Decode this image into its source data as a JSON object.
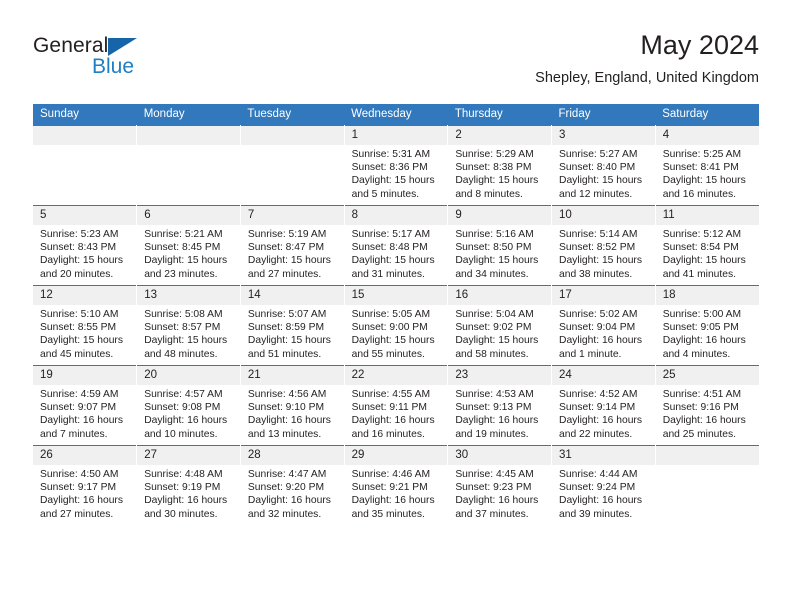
{
  "brand": {
    "name_top": "General",
    "name_bottom": "Blue",
    "triangle_color": "#1565a8",
    "blue_text_color": "#1f7fc4"
  },
  "header": {
    "title": "May 2024",
    "subtitle": "Shepley, England, United Kingdom"
  },
  "theme": {
    "header_bg": "#3278bc",
    "daynum_bg": "#f0f0f0",
    "text": "#231f20"
  },
  "columns": [
    "Sunday",
    "Monday",
    "Tuesday",
    "Wednesday",
    "Thursday",
    "Friday",
    "Saturday"
  ],
  "labels": {
    "sunrise_prefix": "Sunrise:",
    "sunset_prefix": "Sunset:",
    "daylight_prefix": "Daylight:"
  },
  "weeks": [
    [
      {
        "day": "",
        "sunrise": "",
        "sunset": "",
        "daylight_line1": "",
        "daylight_line2": ""
      },
      {
        "day": "",
        "sunrise": "",
        "sunset": "",
        "daylight_line1": "",
        "daylight_line2": ""
      },
      {
        "day": "",
        "sunrise": "",
        "sunset": "",
        "daylight_line1": "",
        "daylight_line2": ""
      },
      {
        "day": "1",
        "sunrise": "Sunrise: 5:31 AM",
        "sunset": "Sunset: 8:36 PM",
        "daylight_line1": "Daylight: 15 hours",
        "daylight_line2": "and 5 minutes."
      },
      {
        "day": "2",
        "sunrise": "Sunrise: 5:29 AM",
        "sunset": "Sunset: 8:38 PM",
        "daylight_line1": "Daylight: 15 hours",
        "daylight_line2": "and 8 minutes."
      },
      {
        "day": "3",
        "sunrise": "Sunrise: 5:27 AM",
        "sunset": "Sunset: 8:40 PM",
        "daylight_line1": "Daylight: 15 hours",
        "daylight_line2": "and 12 minutes."
      },
      {
        "day": "4",
        "sunrise": "Sunrise: 5:25 AM",
        "sunset": "Sunset: 8:41 PM",
        "daylight_line1": "Daylight: 15 hours",
        "daylight_line2": "and 16 minutes."
      }
    ],
    [
      {
        "day": "5",
        "sunrise": "Sunrise: 5:23 AM",
        "sunset": "Sunset: 8:43 PM",
        "daylight_line1": "Daylight: 15 hours",
        "daylight_line2": "and 20 minutes."
      },
      {
        "day": "6",
        "sunrise": "Sunrise: 5:21 AM",
        "sunset": "Sunset: 8:45 PM",
        "daylight_line1": "Daylight: 15 hours",
        "daylight_line2": "and 23 minutes."
      },
      {
        "day": "7",
        "sunrise": "Sunrise: 5:19 AM",
        "sunset": "Sunset: 8:47 PM",
        "daylight_line1": "Daylight: 15 hours",
        "daylight_line2": "and 27 minutes."
      },
      {
        "day": "8",
        "sunrise": "Sunrise: 5:17 AM",
        "sunset": "Sunset: 8:48 PM",
        "daylight_line1": "Daylight: 15 hours",
        "daylight_line2": "and 31 minutes."
      },
      {
        "day": "9",
        "sunrise": "Sunrise: 5:16 AM",
        "sunset": "Sunset: 8:50 PM",
        "daylight_line1": "Daylight: 15 hours",
        "daylight_line2": "and 34 minutes."
      },
      {
        "day": "10",
        "sunrise": "Sunrise: 5:14 AM",
        "sunset": "Sunset: 8:52 PM",
        "daylight_line1": "Daylight: 15 hours",
        "daylight_line2": "and 38 minutes."
      },
      {
        "day": "11",
        "sunrise": "Sunrise: 5:12 AM",
        "sunset": "Sunset: 8:54 PM",
        "daylight_line1": "Daylight: 15 hours",
        "daylight_line2": "and 41 minutes."
      }
    ],
    [
      {
        "day": "12",
        "sunrise": "Sunrise: 5:10 AM",
        "sunset": "Sunset: 8:55 PM",
        "daylight_line1": "Daylight: 15 hours",
        "daylight_line2": "and 45 minutes."
      },
      {
        "day": "13",
        "sunrise": "Sunrise: 5:08 AM",
        "sunset": "Sunset: 8:57 PM",
        "daylight_line1": "Daylight: 15 hours",
        "daylight_line2": "and 48 minutes."
      },
      {
        "day": "14",
        "sunrise": "Sunrise: 5:07 AM",
        "sunset": "Sunset: 8:59 PM",
        "daylight_line1": "Daylight: 15 hours",
        "daylight_line2": "and 51 minutes."
      },
      {
        "day": "15",
        "sunrise": "Sunrise: 5:05 AM",
        "sunset": "Sunset: 9:00 PM",
        "daylight_line1": "Daylight: 15 hours",
        "daylight_line2": "and 55 minutes."
      },
      {
        "day": "16",
        "sunrise": "Sunrise: 5:04 AM",
        "sunset": "Sunset: 9:02 PM",
        "daylight_line1": "Daylight: 15 hours",
        "daylight_line2": "and 58 minutes."
      },
      {
        "day": "17",
        "sunrise": "Sunrise: 5:02 AM",
        "sunset": "Sunset: 9:04 PM",
        "daylight_line1": "Daylight: 16 hours",
        "daylight_line2": "and 1 minute."
      },
      {
        "day": "18",
        "sunrise": "Sunrise: 5:00 AM",
        "sunset": "Sunset: 9:05 PM",
        "daylight_line1": "Daylight: 16 hours",
        "daylight_line2": "and 4 minutes."
      }
    ],
    [
      {
        "day": "19",
        "sunrise": "Sunrise: 4:59 AM",
        "sunset": "Sunset: 9:07 PM",
        "daylight_line1": "Daylight: 16 hours",
        "daylight_line2": "and 7 minutes."
      },
      {
        "day": "20",
        "sunrise": "Sunrise: 4:57 AM",
        "sunset": "Sunset: 9:08 PM",
        "daylight_line1": "Daylight: 16 hours",
        "daylight_line2": "and 10 minutes."
      },
      {
        "day": "21",
        "sunrise": "Sunrise: 4:56 AM",
        "sunset": "Sunset: 9:10 PM",
        "daylight_line1": "Daylight: 16 hours",
        "daylight_line2": "and 13 minutes."
      },
      {
        "day": "22",
        "sunrise": "Sunrise: 4:55 AM",
        "sunset": "Sunset: 9:11 PM",
        "daylight_line1": "Daylight: 16 hours",
        "daylight_line2": "and 16 minutes."
      },
      {
        "day": "23",
        "sunrise": "Sunrise: 4:53 AM",
        "sunset": "Sunset: 9:13 PM",
        "daylight_line1": "Daylight: 16 hours",
        "daylight_line2": "and 19 minutes."
      },
      {
        "day": "24",
        "sunrise": "Sunrise: 4:52 AM",
        "sunset": "Sunset: 9:14 PM",
        "daylight_line1": "Daylight: 16 hours",
        "daylight_line2": "and 22 minutes."
      },
      {
        "day": "25",
        "sunrise": "Sunrise: 4:51 AM",
        "sunset": "Sunset: 9:16 PM",
        "daylight_line1": "Daylight: 16 hours",
        "daylight_line2": "and 25 minutes."
      }
    ],
    [
      {
        "day": "26",
        "sunrise": "Sunrise: 4:50 AM",
        "sunset": "Sunset: 9:17 PM",
        "daylight_line1": "Daylight: 16 hours",
        "daylight_line2": "and 27 minutes."
      },
      {
        "day": "27",
        "sunrise": "Sunrise: 4:48 AM",
        "sunset": "Sunset: 9:19 PM",
        "daylight_line1": "Daylight: 16 hours",
        "daylight_line2": "and 30 minutes."
      },
      {
        "day": "28",
        "sunrise": "Sunrise: 4:47 AM",
        "sunset": "Sunset: 9:20 PM",
        "daylight_line1": "Daylight: 16 hours",
        "daylight_line2": "and 32 minutes."
      },
      {
        "day": "29",
        "sunrise": "Sunrise: 4:46 AM",
        "sunset": "Sunset: 9:21 PM",
        "daylight_line1": "Daylight: 16 hours",
        "daylight_line2": "and 35 minutes."
      },
      {
        "day": "30",
        "sunrise": "Sunrise: 4:45 AM",
        "sunset": "Sunset: 9:23 PM",
        "daylight_line1": "Daylight: 16 hours",
        "daylight_line2": "and 37 minutes."
      },
      {
        "day": "31",
        "sunrise": "Sunrise: 4:44 AM",
        "sunset": "Sunset: 9:24 PM",
        "daylight_line1": "Daylight: 16 hours",
        "daylight_line2": "and 39 minutes."
      },
      {
        "day": "",
        "sunrise": "",
        "sunset": "",
        "daylight_line1": "",
        "daylight_line2": ""
      }
    ]
  ]
}
